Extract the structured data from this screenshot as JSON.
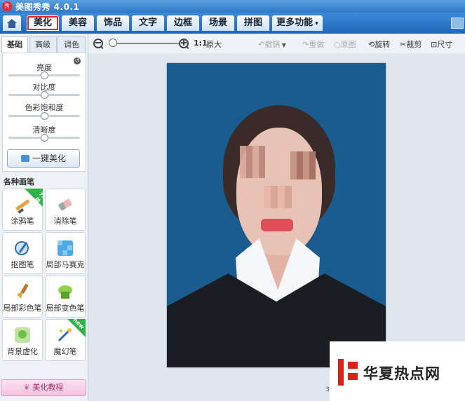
{
  "app": {
    "title": "美图秀秀 4.0.1",
    "logo_text": "秀"
  },
  "nav": {
    "home_icon": "home-icon",
    "tabs": [
      "美化",
      "美容",
      "饰品",
      "文字",
      "边框",
      "场景",
      "拼图",
      "更多功能"
    ],
    "active_tab": "美化"
  },
  "left": {
    "subtabs": [
      "基础",
      "高级",
      "调色"
    ],
    "active_subtab": "基础",
    "sliders": [
      {
        "label": "亮度",
        "value": 0.5
      },
      {
        "label": "对比度",
        "value": 0.5
      },
      {
        "label": "色彩饱和度",
        "value": 0.5
      },
      {
        "label": "清晰度",
        "value": 0.5
      }
    ],
    "one_click_label": "一键美化",
    "section_title": "各种画笔",
    "brushes": [
      {
        "label": "涂鸦笔",
        "badge": "升级"
      },
      {
        "label": "消除笔",
        "badge": ""
      },
      {
        "label": "抠图笔",
        "badge": ""
      },
      {
        "label": "局部马赛克",
        "badge": ""
      },
      {
        "label": "局部彩色笔",
        "badge": ""
      },
      {
        "label": "局部变色笔",
        "badge": ""
      },
      {
        "label": "背景虚化",
        "badge": ""
      },
      {
        "label": "魔幻笔",
        "badge": "new"
      }
    ],
    "tutorial_label": "美化教程"
  },
  "toolbar": {
    "zoom_value": 0.05,
    "actual_size_label": "1:1",
    "original_size_label": "原大",
    "undo_label": "撤销",
    "redo_label": "重做",
    "original_label": "原图",
    "rotate_label": "旋转",
    "crop_label": "裁剪",
    "size_label": "尺寸"
  },
  "watermark": {
    "text": "华夏热点网"
  },
  "page_num": "3"
}
